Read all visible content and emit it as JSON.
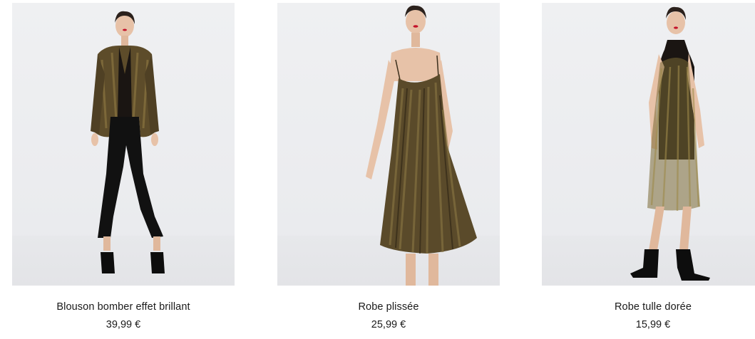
{
  "products": [
    {
      "name": "Blouson bomber effet brillant",
      "price": "39,99 €"
    },
    {
      "name": "Robe plissée",
      "price": "25,99 €"
    },
    {
      "name": "Robe tulle dorée",
      "price": "15,99 €"
    }
  ],
  "colors": {
    "text": "#1a1a1a",
    "photo_background": "#eeeff1",
    "metallic_gold": "#6b5a2e"
  }
}
